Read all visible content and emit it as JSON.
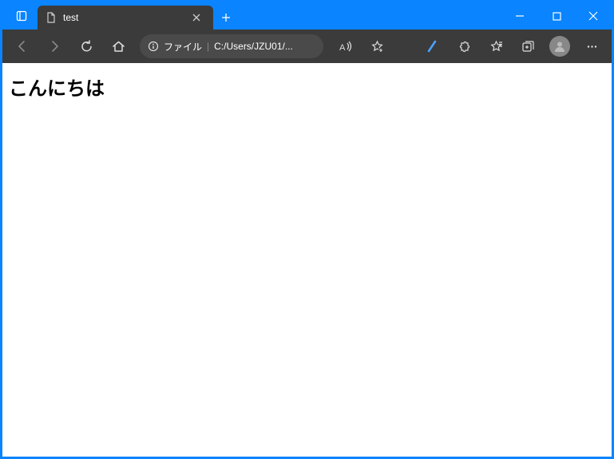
{
  "tab": {
    "title": "test"
  },
  "address": {
    "scheme_label": "ファイル",
    "path": "C:/Users/JZU01/..."
  },
  "page": {
    "heading": "こんにちは"
  }
}
